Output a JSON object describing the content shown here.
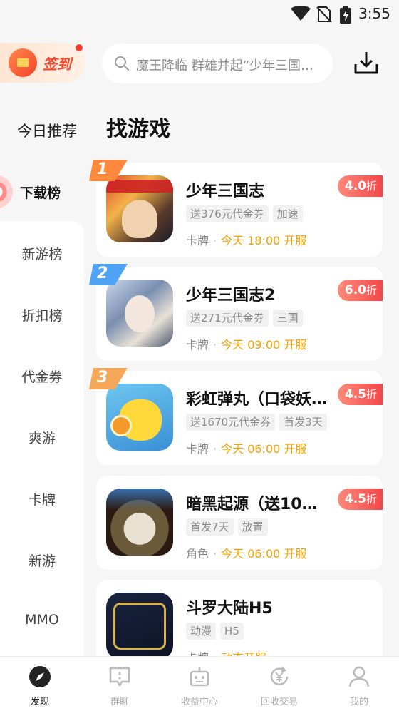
{
  "status": {
    "time": "3:55"
  },
  "header": {
    "checkin_label": "签到",
    "search_placeholder": "魔王降临 群雄并起“少年三国…"
  },
  "section": {
    "today_label": "今日推荐",
    "title": "找游戏"
  },
  "sidebar": {
    "active": "下载榜",
    "items": [
      "新游榜",
      "折扣榜",
      "代金券",
      "爽游",
      "卡牌",
      "新游",
      "MMO"
    ]
  },
  "games": [
    {
      "rank": "1",
      "name": "少年三国志",
      "discount": "4.0",
      "discount_unit": "折",
      "tags": [
        "送376元代金券",
        "加速"
      ],
      "category": "卡牌",
      "open": "今天 18:00 开服"
    },
    {
      "rank": "2",
      "name": "少年三国志2",
      "discount": "6.0",
      "discount_unit": "折",
      "tags": [
        "送271元代金券",
        "三国"
      ],
      "category": "卡牌",
      "open": "今天 09:00 开服"
    },
    {
      "rank": "3",
      "name": "彩虹弹丸（口袋妖…",
      "discount": "4.5",
      "discount_unit": "折",
      "tags": [
        "送1670元代金券",
        "首发3天"
      ],
      "category": "卡牌",
      "open": "今天 06:00 开服"
    },
    {
      "rank": "",
      "name": "暗黑起源（送10…",
      "discount": "4.5",
      "discount_unit": "折",
      "tags": [
        "首发7天",
        "放置"
      ],
      "category": "角色",
      "open": "今天 06:00 开服"
    },
    {
      "rank": "",
      "name": "斗罗大陆H5",
      "discount": "",
      "discount_unit": "",
      "tags": [
        "动漫",
        "H5"
      ],
      "category": "卡牌",
      "open": "动态开服"
    }
  ],
  "bottom_nav": [
    {
      "label": "发现",
      "icon": "compass-icon",
      "active": true
    },
    {
      "label": "群聊",
      "icon": "chat-icon",
      "active": false
    },
    {
      "label": "收益中心",
      "icon": "robot-icon",
      "active": false
    },
    {
      "label": "回收交易",
      "icon": "yen-recycle-icon",
      "active": false
    },
    {
      "label": "我的",
      "icon": "person-icon",
      "active": false
    }
  ],
  "colors": {
    "accent_orange": "#f5a200",
    "discount_red": "#f2474a",
    "background": "#f6f6f7"
  }
}
